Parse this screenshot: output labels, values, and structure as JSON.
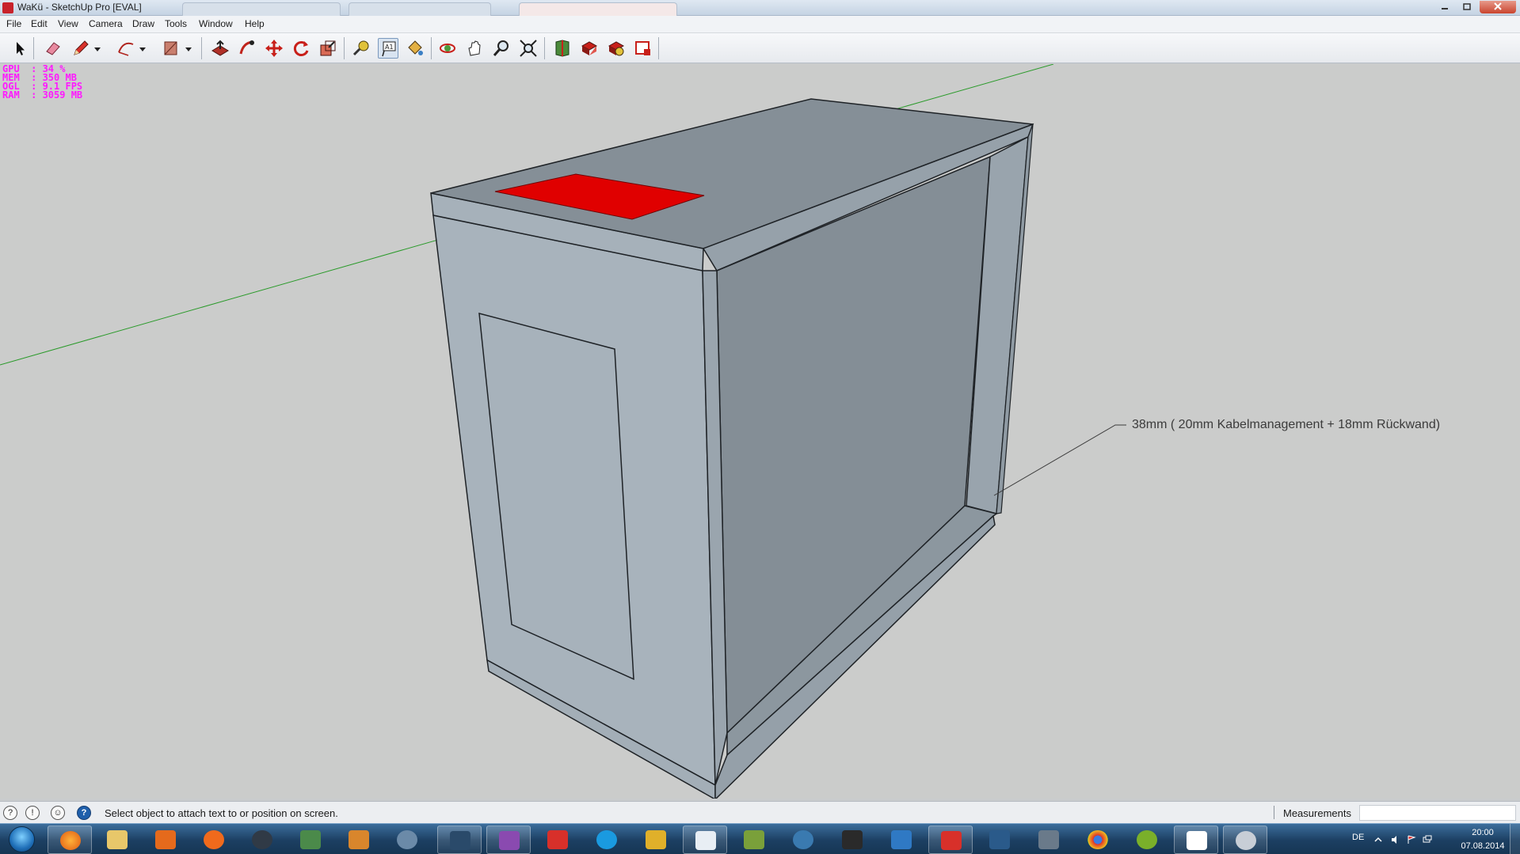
{
  "window": {
    "title": "WaKü - SketchUp Pro [EVAL]"
  },
  "menu": {
    "items": [
      "File",
      "Edit",
      "View",
      "Camera",
      "Draw",
      "Tools",
      "Window",
      "Help"
    ]
  },
  "toolbar": {
    "tools": [
      "select-icon",
      "eraser-icon",
      "pencil-icon",
      "arc-icon",
      "rectangle-icon",
      "push-pull-icon",
      "follow-me-icon",
      "move-icon",
      "rotate-icon",
      "scale-icon",
      "tape-measure-icon",
      "text-icon",
      "paint-bucket-icon",
      "orbit-icon",
      "pan-icon",
      "zoom-icon",
      "zoom-extents-icon",
      "3d-warehouse-icon",
      "share-model-icon",
      "extension-warehouse-icon",
      "layout-icon"
    ],
    "active_tool": "text-icon"
  },
  "stats": {
    "gpu": "GPU  : 34 %",
    "mem": "MEM  : 350 MB",
    "ogl": "OGL  : 9.1 FPS",
    "ram": "RAM  : 3059 MB"
  },
  "model": {
    "dimension_label": "38mm ( 20mm Kabelmanagement + 18mm Rückwand)",
    "highlight_color": "#e00000",
    "face_color": "#9ea9b3",
    "axis_color": "#2a9a2a"
  },
  "statusbar": {
    "text": "Select object to attach text to or position on screen.",
    "measurements_label": "Measurements",
    "measurements_value": ""
  },
  "taskbar": {
    "language": "DE",
    "time": "20:00",
    "date": "07.08.2014"
  }
}
